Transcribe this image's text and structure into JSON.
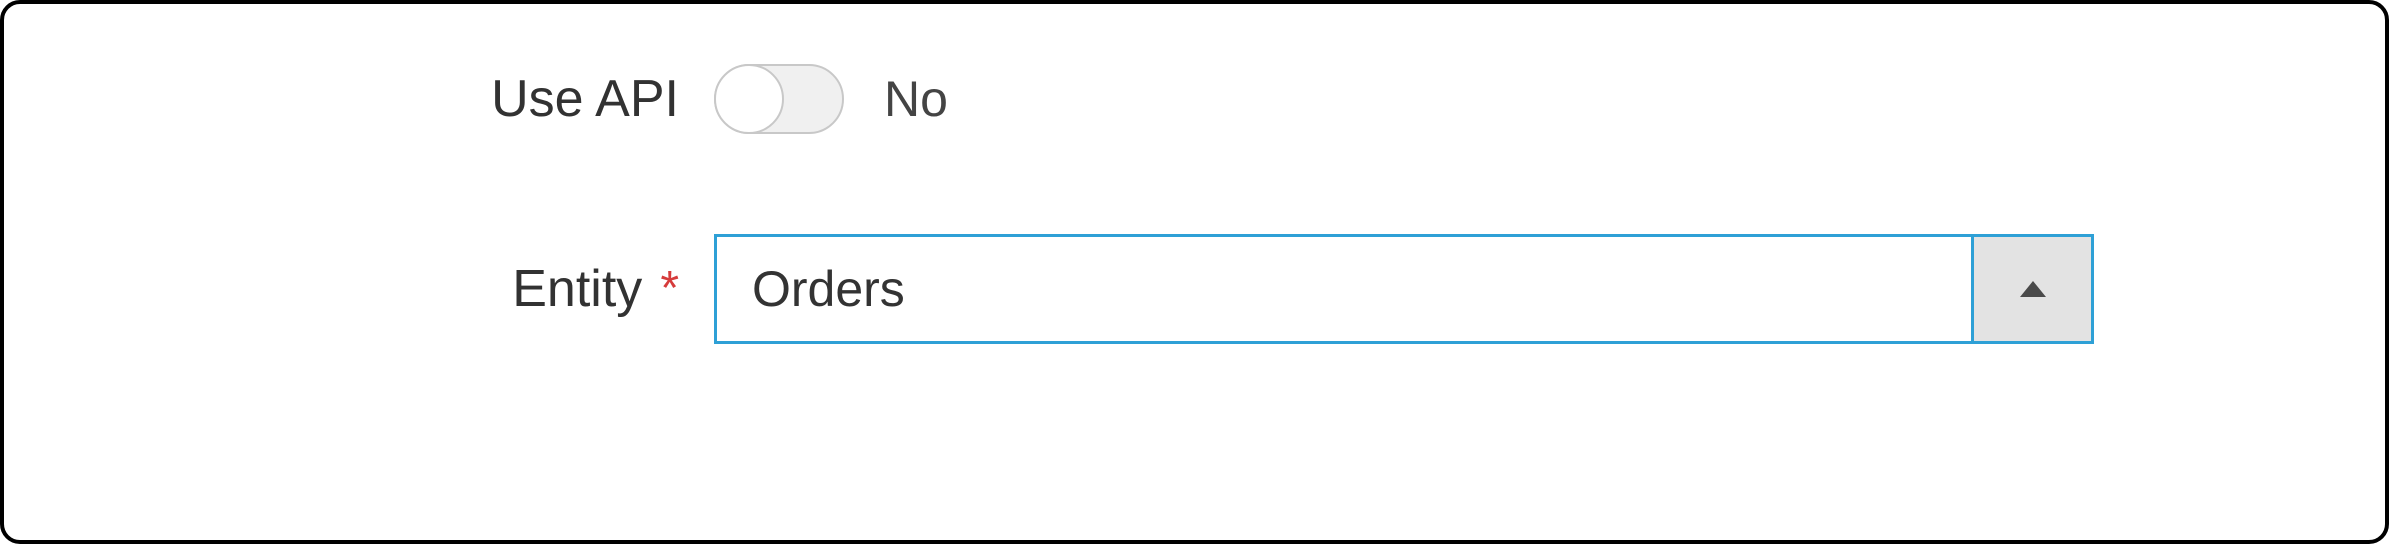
{
  "fields": {
    "use_api": {
      "label": "Use API",
      "state_label": "No",
      "on": false
    },
    "entity": {
      "label": "Entity",
      "required_mark": "*",
      "value": "Orders"
    }
  }
}
